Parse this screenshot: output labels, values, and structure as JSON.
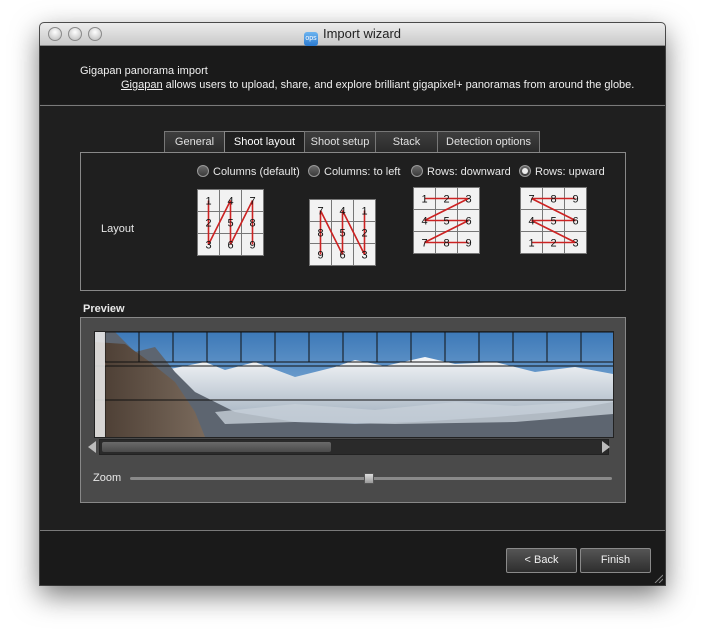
{
  "window": {
    "title": "Import wizard",
    "app_icon_text": "ops"
  },
  "header": {
    "title": "Gigapan panorama import",
    "link_text": "Gigapan",
    "description": " allows users to upload, share, and explore brilliant gigapixel+ panoramas from around the globe."
  },
  "tabs": [
    {
      "label": "General",
      "active": false
    },
    {
      "label": "Shoot layout",
      "active": true
    },
    {
      "label": "Shoot setup",
      "active": false
    },
    {
      "label": "Stack",
      "active": false
    },
    {
      "label": "Detection options",
      "active": false
    }
  ],
  "layout": {
    "label": "Layout",
    "options": [
      {
        "label": "Columns (default)",
        "selected": false,
        "grid": [
          [
            "1",
            "4",
            "7"
          ],
          [
            "2",
            "5",
            "8"
          ],
          [
            "3",
            "6",
            "9"
          ]
        ]
      },
      {
        "label": "Columns: to left",
        "selected": false,
        "grid": [
          [
            "7",
            "4",
            "1"
          ],
          [
            "8",
            "5",
            "2"
          ],
          [
            "9",
            "6",
            "3"
          ]
        ]
      },
      {
        "label": "Rows: downward",
        "selected": false,
        "grid": [
          [
            "1",
            "2",
            "3"
          ],
          [
            "4",
            "5",
            "6"
          ],
          [
            "7",
            "8",
            "9"
          ]
        ]
      },
      {
        "label": "Rows: upward",
        "selected": true,
        "grid": [
          [
            "7",
            "8",
            "9"
          ],
          [
            "4",
            "5",
            "6"
          ],
          [
            "1",
            "2",
            "3"
          ]
        ]
      }
    ]
  },
  "preview": {
    "label": "Preview",
    "zoom_label": "Zoom",
    "zoom_level": 0.49,
    "scroll_position": 0.0,
    "scroll_visible_fraction": 0.46
  },
  "buttons": {
    "back": "< Back",
    "finish": "Finish"
  },
  "colors": {
    "arrow": "#cc2222",
    "background": "#1f1f1f"
  }
}
